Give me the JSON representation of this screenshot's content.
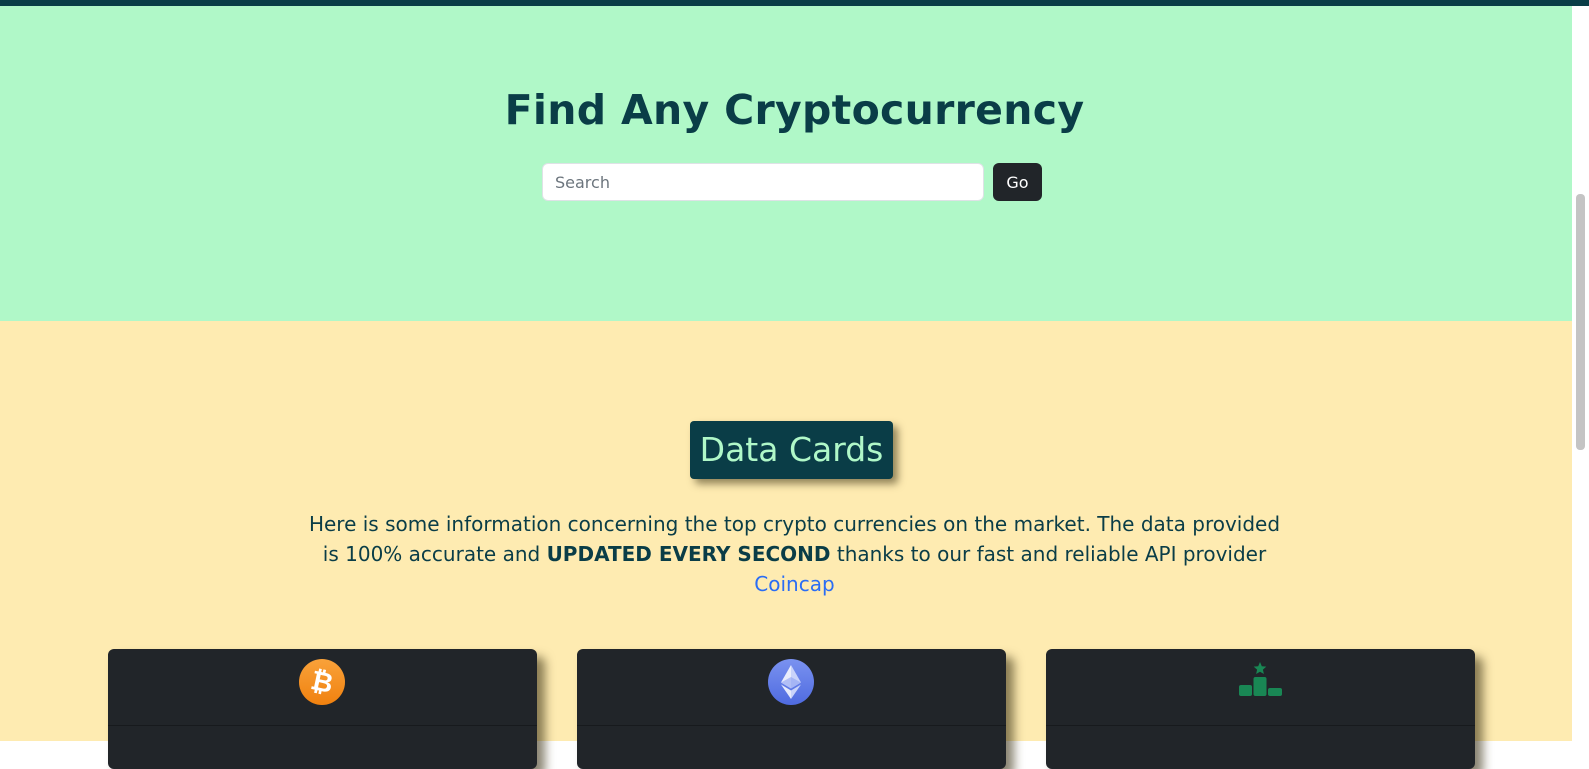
{
  "hero": {
    "title": "Find Any Cryptocurrency",
    "search_placeholder": "Search",
    "go_label": "Go"
  },
  "section": {
    "badge": "Data Cards",
    "desc_part1": "Here is some information concerning the top crypto currencies on the market. The data provided is 100% accurate and ",
    "desc_bold": "UPDATED EVERY SECOND",
    "desc_part2": " thanks to our fast and reliable API provider ",
    "link_text": "Coincap"
  },
  "cards": [
    {
      "icon": "bitcoin-icon"
    },
    {
      "icon": "ethereum-icon"
    },
    {
      "icon": "ranking-podium-icon"
    }
  ],
  "colors": {
    "topbar": "#0a3d47",
    "hero_bg": "#b0f8c8",
    "section_bg": "#feebb1",
    "card_bg": "#212529",
    "link": "#2a6df4",
    "bitcoin": "#f7931a",
    "ethereum": "#627eea",
    "ranking": "#198754"
  }
}
